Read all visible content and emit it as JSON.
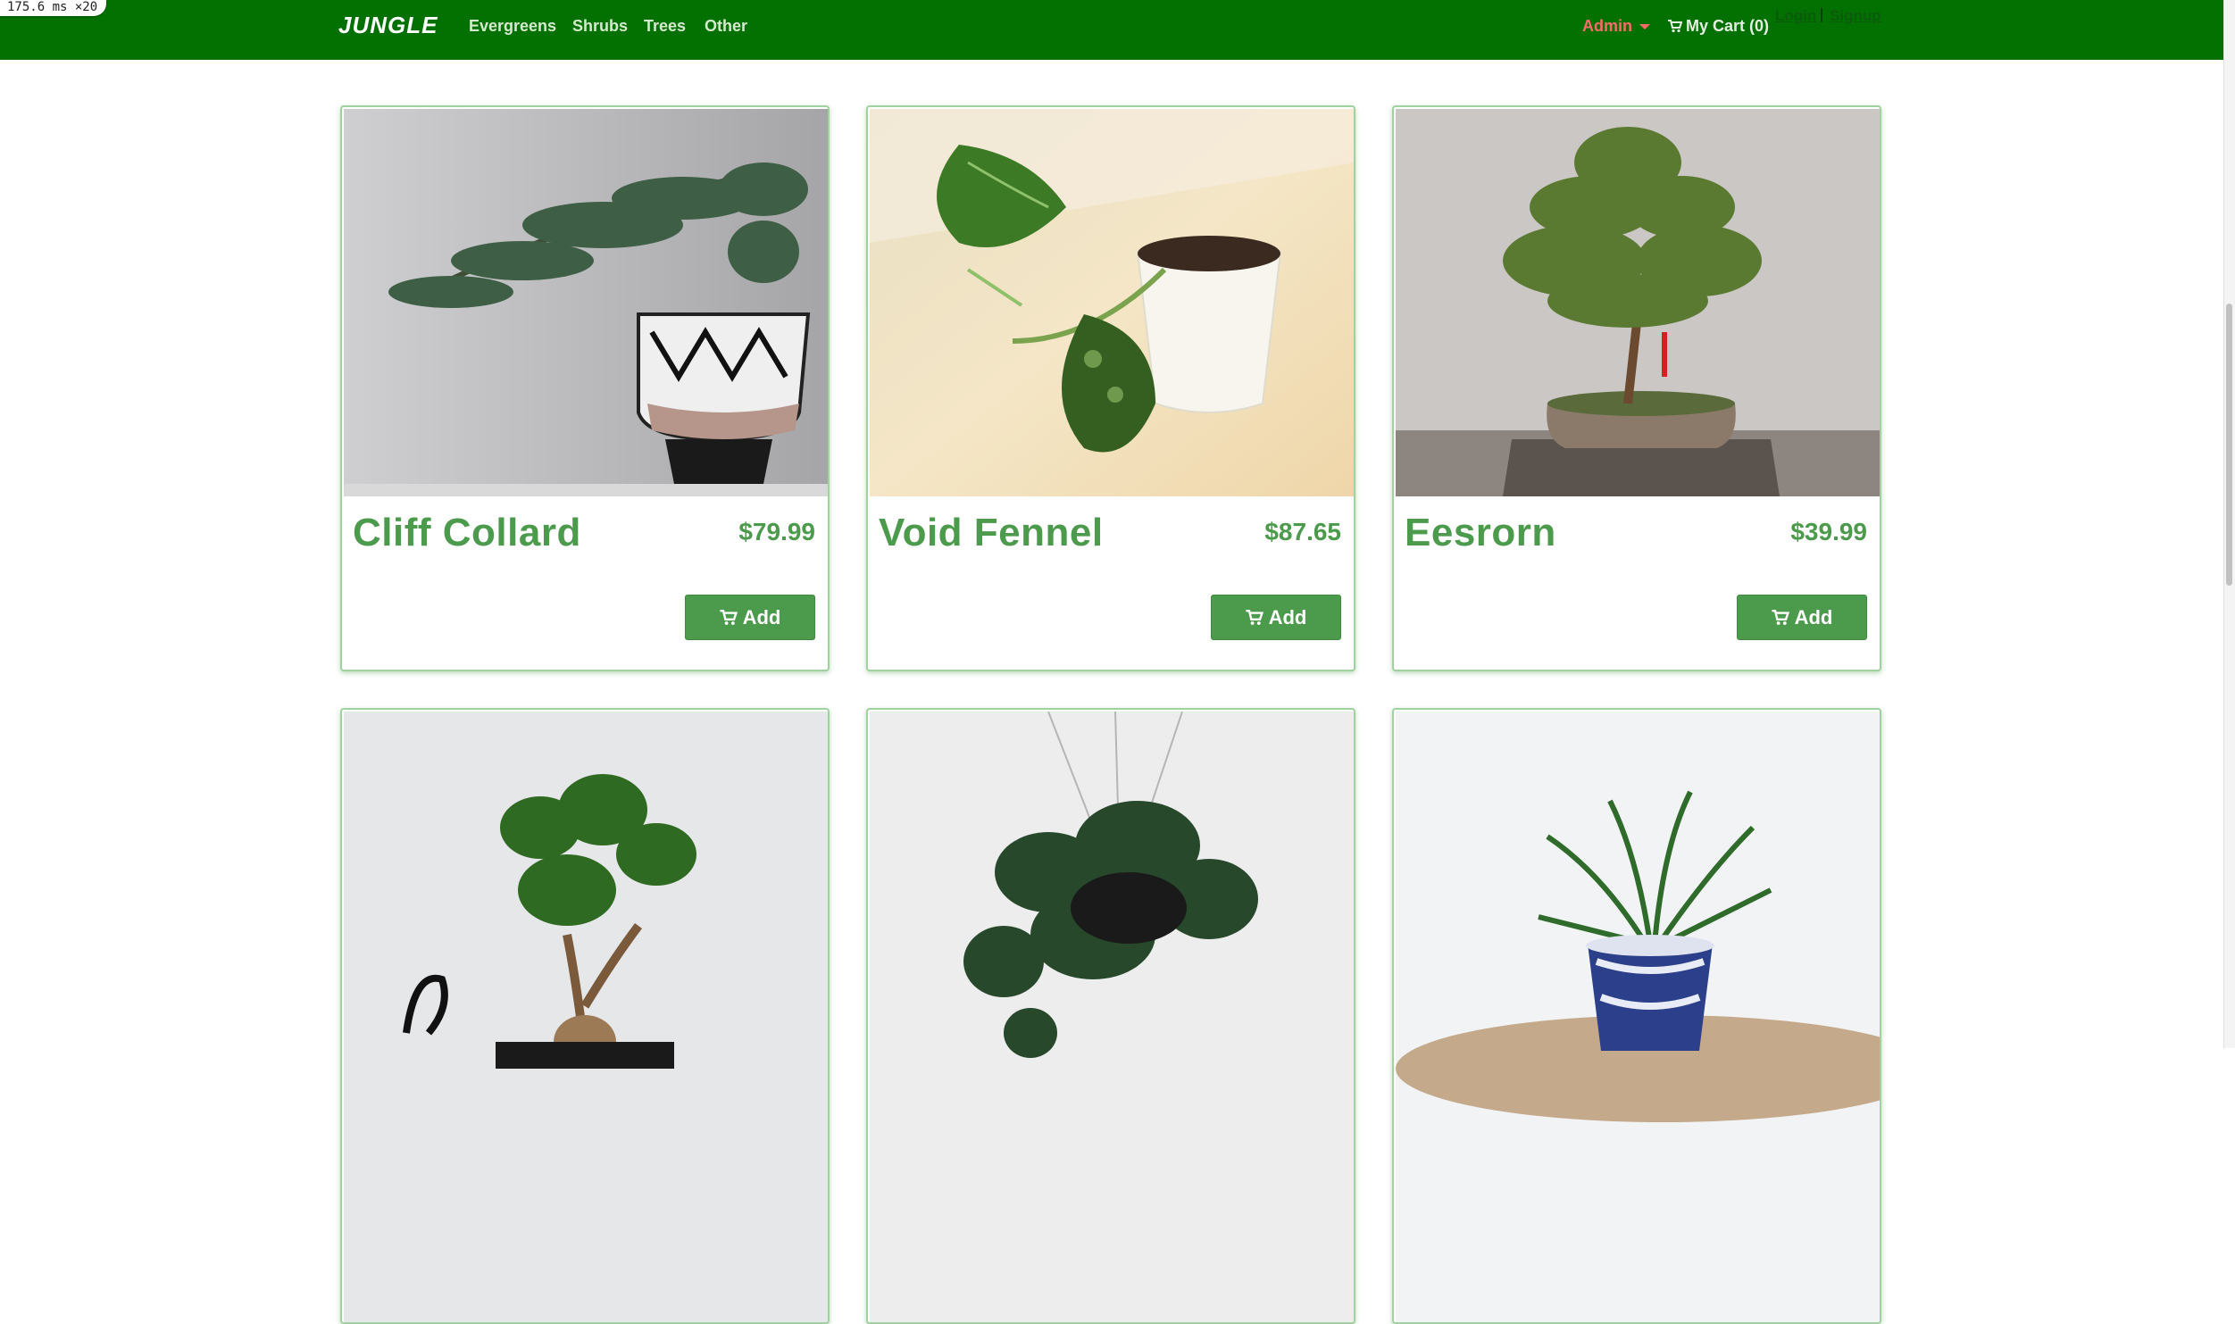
{
  "perf_badge": "175.6 ms ×20",
  "nav": {
    "brand": "JUNGLE",
    "links": [
      "Evergreens",
      "Shrubs",
      "Trees",
      "Other"
    ],
    "admin_label": "Admin",
    "cart_label": "My Cart (0)",
    "login_label": "Login",
    "signup_label": "Signup"
  },
  "products": [
    {
      "name": "Cliff Collard",
      "price": "$79.99",
      "add_label": "Add",
      "image": "juniper-bonsai-in-patterned-pot"
    },
    {
      "name": "Void Fennel",
      "price": "$87.65",
      "add_label": "Add",
      "image": "pothos-cutting-in-white-cup"
    },
    {
      "name": "Eesrorn",
      "price": "$39.99",
      "add_label": "Add",
      "image": "bonsai-tree-in-clay-tray"
    },
    {
      "image": "ficus-bonsai-small"
    },
    {
      "image": "hanging-philodendron"
    },
    {
      "image": "palm-in-blue-white-pot"
    }
  ],
  "colors": {
    "navbar": "#027102",
    "accent": "#4c9a4c",
    "admin": "#ff6b6b",
    "card_border": "#9fd29f"
  }
}
